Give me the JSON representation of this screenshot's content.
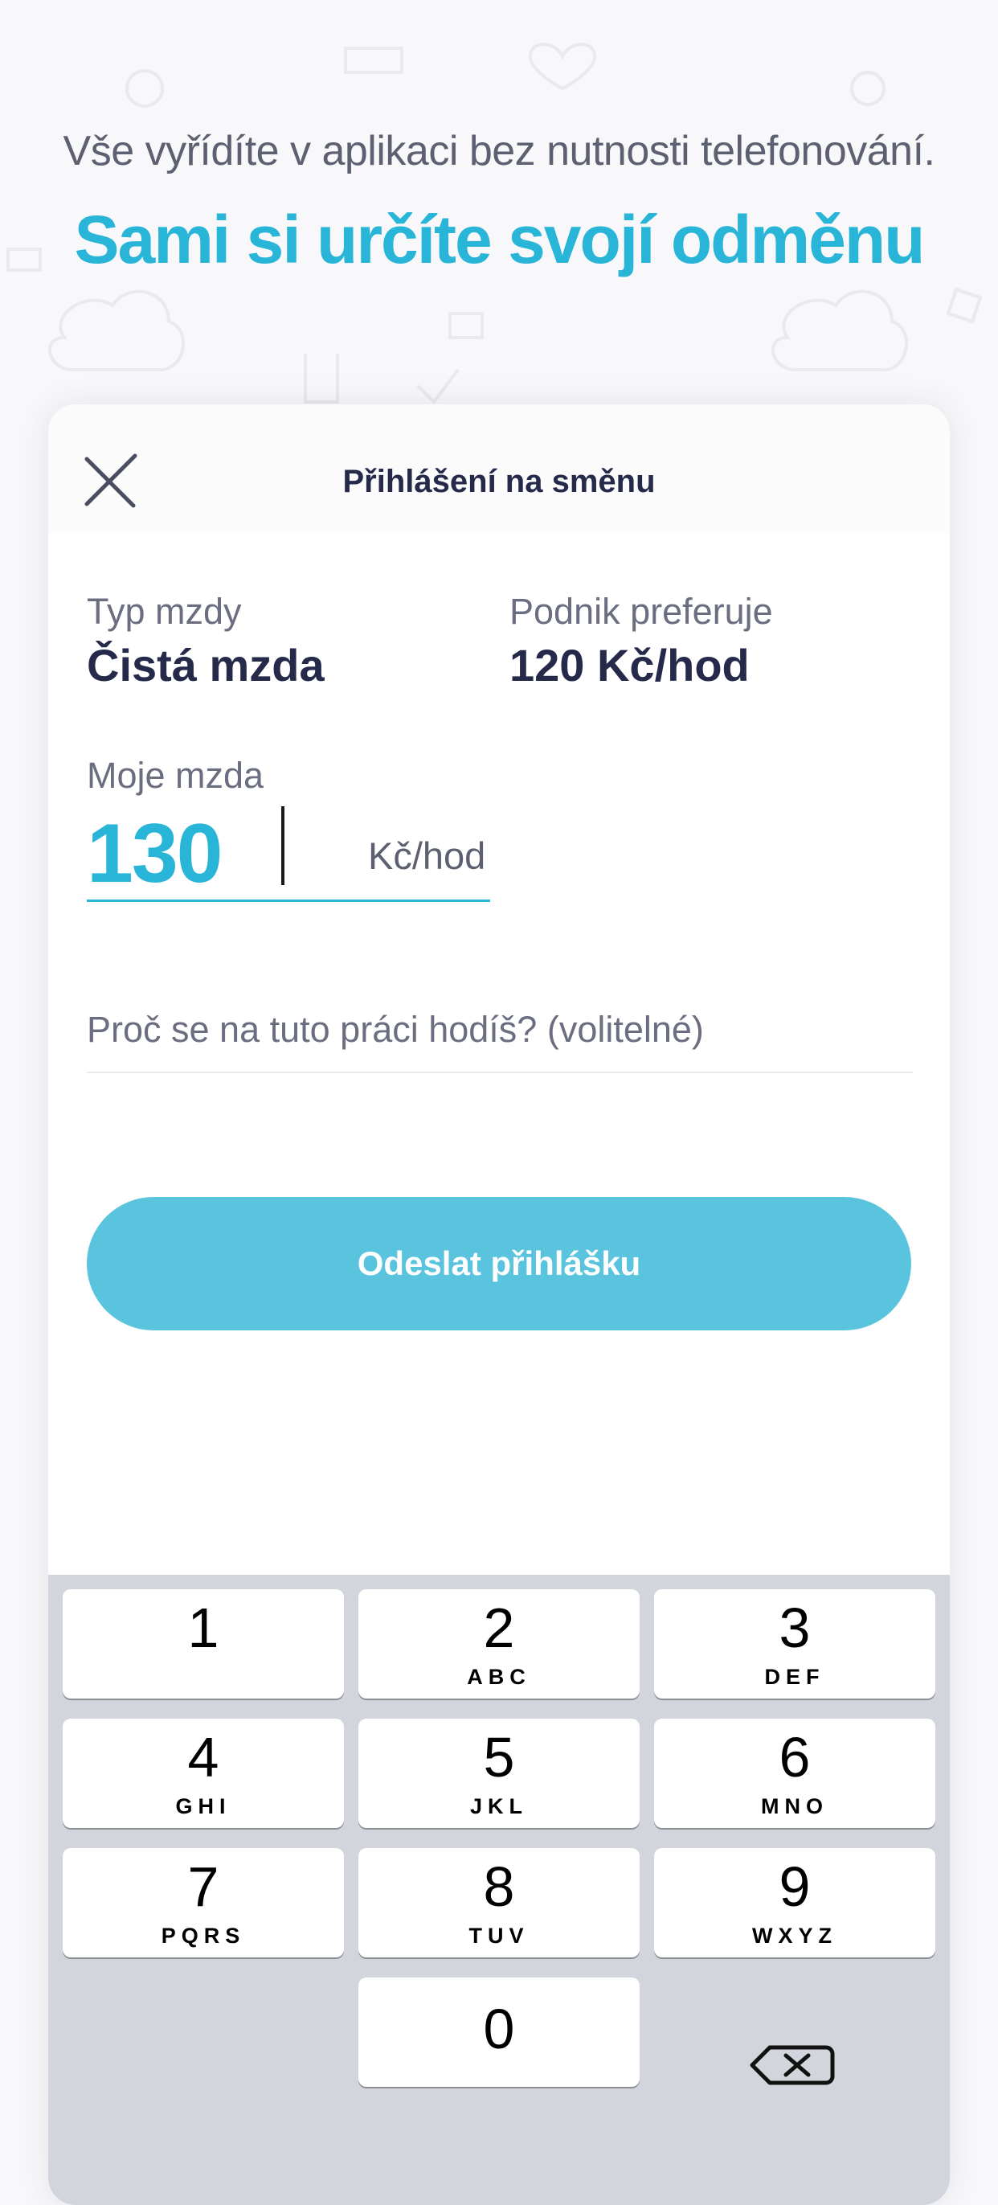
{
  "promo": {
    "subtitle": "Vše vyřídíte v aplikaci bez nutnosti telefonování.",
    "title": "Sami si určíte svojí odměnu"
  },
  "modal": {
    "title": "Přihlášení na směnu",
    "close_icon": "close-icon",
    "wage_type": {
      "label": "Typ mzdy",
      "value": "Čistá mzda"
    },
    "preferred": {
      "label": "Podnik preferuje",
      "value": "120 Kč/hod"
    },
    "my_wage": {
      "label": "Moje mzda",
      "value": "130",
      "unit": "Kč/hod"
    },
    "reason": {
      "placeholder": "Proč se na tuto práci hodíš? (volitelné)",
      "value": ""
    },
    "submit_label": "Odeslat přihlášku"
  },
  "keyboard": {
    "keys": [
      {
        "digit": "1",
        "letters": ""
      },
      {
        "digit": "2",
        "letters": "ABC"
      },
      {
        "digit": "3",
        "letters": "DEF"
      },
      {
        "digit": "4",
        "letters": "GHI"
      },
      {
        "digit": "5",
        "letters": "JKL"
      },
      {
        "digit": "6",
        "letters": "MNO"
      },
      {
        "digit": "7",
        "letters": "PQRS"
      },
      {
        "digit": "8",
        "letters": "TUV"
      },
      {
        "digit": "9",
        "letters": "WXYZ"
      },
      {
        "digit": "0",
        "letters": ""
      }
    ],
    "delete_icon": "backspace-icon"
  },
  "colors": {
    "accent": "#28b5d8",
    "button": "#5ac4de",
    "text_dark": "#262a4a",
    "text_muted": "#6b6e80",
    "keyboard_bg": "#d2d5db"
  }
}
